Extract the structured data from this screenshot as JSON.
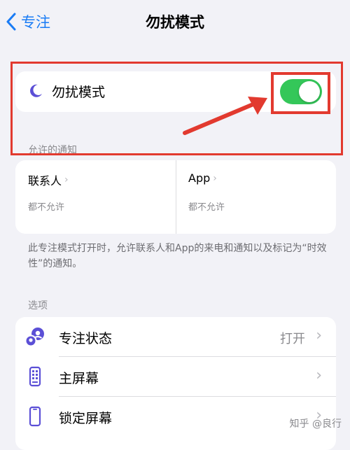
{
  "nav": {
    "back_label": "专注",
    "title": "勿扰模式"
  },
  "dnd": {
    "label": "勿扰模式",
    "enabled": true
  },
  "allowed": {
    "section_label": "允许的通知",
    "people": {
      "title": "联系人",
      "subtitle": "都不允许"
    },
    "apps": {
      "title": "App",
      "subtitle": "都不允许"
    }
  },
  "description": "此专注模式打开时，允许联系人和App的来电和通知以及标记为“时效性”的通知。",
  "options": {
    "section_label": "选项",
    "items": [
      {
        "label": "专注状态",
        "value": "打开",
        "icon": "focus-status-icon"
      },
      {
        "label": "主屏幕",
        "value": "",
        "icon": "home-screen-icon"
      },
      {
        "label": "锁定屏幕",
        "value": "",
        "icon": "lock-screen-icon"
      }
    ]
  },
  "watermark": "知乎 @良行",
  "colors": {
    "accent": "#1a7cf5",
    "toggle_on": "#34c759",
    "highlight": "#e23a2f",
    "moon": "#5b4fd6"
  }
}
